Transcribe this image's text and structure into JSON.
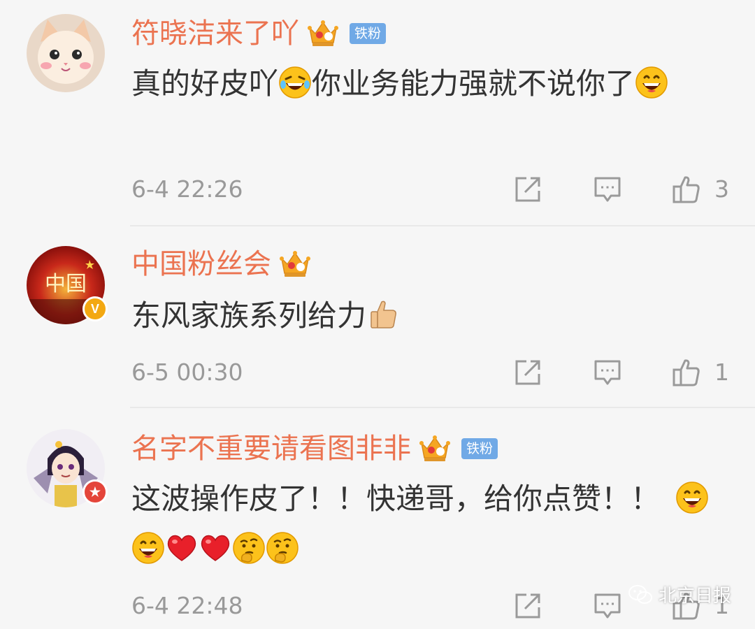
{
  "comments": [
    {
      "username": "符晓洁来了吖",
      "crown_level": "2",
      "fan_badge": "铁粉",
      "text_parts": [
        "真的好皮吖",
        "你业务能力强就不说你了"
      ],
      "timestamp": "6-4 22:26",
      "like_count": "3"
    },
    {
      "username": "中国粉丝会",
      "crown_level": "5",
      "avatar_text": "中国",
      "text_parts": [
        "东风家族系列给力"
      ],
      "timestamp": "6-5 00:30",
      "like_count": "1"
    },
    {
      "username": "名字不重要请看图非非",
      "crown_level": "1",
      "fan_badge": "铁粉",
      "text_parts": [
        "这波操作皮了！！快递哥，给你点赞！！"
      ],
      "timestamp": "6-4 22:48",
      "like_count": "1"
    }
  ],
  "watermark": {
    "label": "北京日报",
    "icon": "wechat-icon"
  },
  "icons": [
    "forward-icon",
    "reply-icon",
    "like-icon",
    "crown-icon",
    "laughing-emoji",
    "grin-emoji",
    "thumbs-up-emoji",
    "heart-emoji",
    "thinking-emoji"
  ],
  "colors": {
    "username": "#eb7350",
    "fan_badge_bg": "#70a9e6",
    "crown": "#f5a623",
    "meta_text": "#999999",
    "background": "#f6f6f6"
  }
}
